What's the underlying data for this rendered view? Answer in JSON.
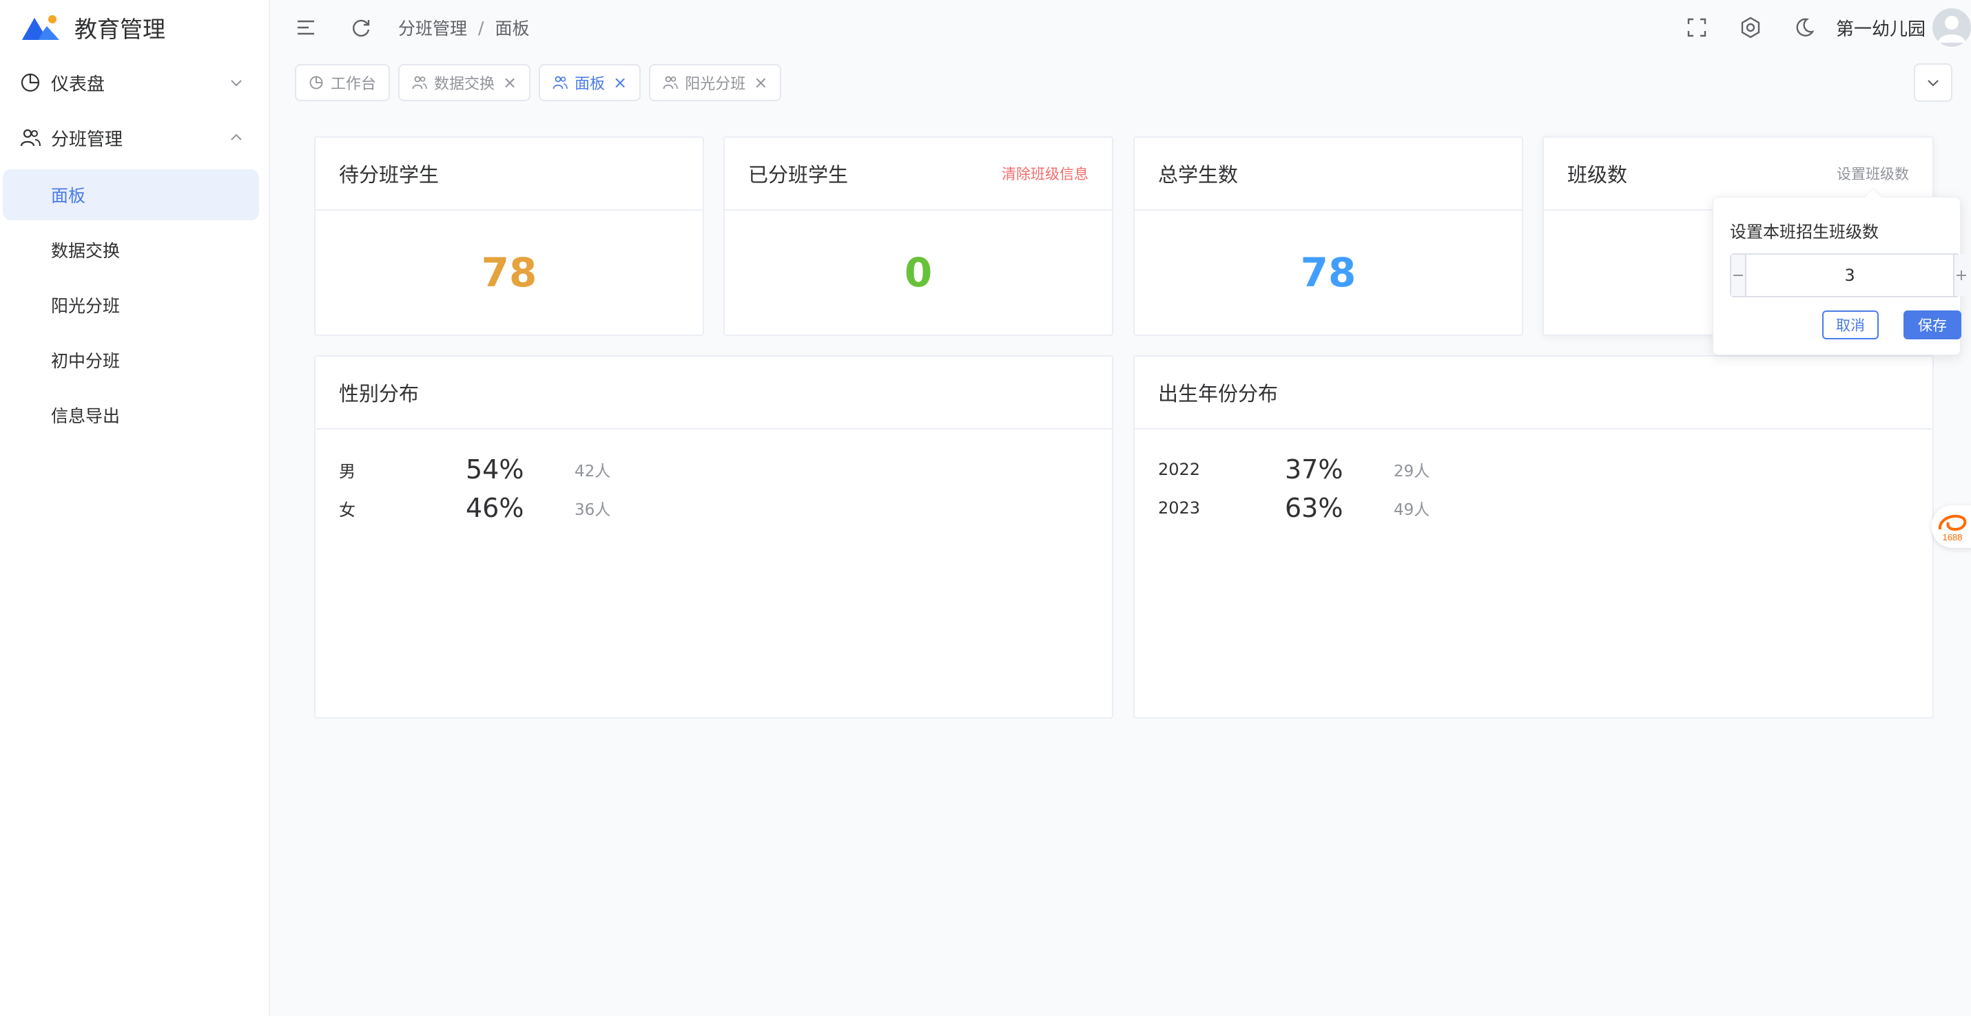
{
  "app": {
    "title": "教育管理"
  },
  "sidebar": {
    "items": [
      {
        "label": "仪表盘",
        "icon": "pie-chart-icon",
        "expanded": false
      },
      {
        "label": "分班管理",
        "icon": "users-icon",
        "expanded": true,
        "children": [
          {
            "label": "面板",
            "active": true
          },
          {
            "label": "数据交换",
            "active": false
          },
          {
            "label": "阳光分班",
            "active": false
          },
          {
            "label": "初中分班",
            "active": false
          },
          {
            "label": "信息导出",
            "active": false
          }
        ]
      }
    ]
  },
  "header": {
    "breadcrumb": [
      "分班管理",
      "面板"
    ],
    "breadcrumb_sep": "/",
    "username": "第一幼儿园"
  },
  "tabs": [
    {
      "label": "工作台",
      "icon": "pie-chart-icon",
      "closable": false,
      "active": false
    },
    {
      "label": "数据交换",
      "icon": "users-icon",
      "closable": true,
      "active": false
    },
    {
      "label": "面板",
      "icon": "users-icon",
      "closable": true,
      "active": true
    },
    {
      "label": "阳光分班",
      "icon": "users-icon",
      "closable": true,
      "active": false
    }
  ],
  "stats": [
    {
      "title": "待分班学生",
      "value": "78",
      "color": "#e6a23c",
      "link": ""
    },
    {
      "title": "已分班学生",
      "value": "0",
      "color": "#67c23a",
      "link": "清除班级信息",
      "link_color": "#f56c6c"
    },
    {
      "title": "总学生数",
      "value": "78",
      "color": "#409eff",
      "link": ""
    },
    {
      "title": "班级数",
      "value": "",
      "color": "#409eff",
      "link": "设置班级数",
      "link_color": "#909399"
    }
  ],
  "gender": {
    "title": "性别分布",
    "rows": [
      {
        "label": "男",
        "percent": "54%",
        "count": "42人"
      },
      {
        "label": "女",
        "percent": "46%",
        "count": "36人"
      }
    ]
  },
  "birth_year": {
    "title": "出生年份分布",
    "rows": [
      {
        "label": "2022",
        "percent": "37%",
        "count": "29人"
      },
      {
        "label": "2023",
        "percent": "63%",
        "count": "49人"
      }
    ]
  },
  "popover": {
    "title": "设置本班招生班级数",
    "value": "3",
    "cancel_label": "取消",
    "save_label": "保存"
  },
  "colors": {
    "primary": "#4a7be8",
    "danger": "#f56c6c",
    "badge": "#ff6a00"
  },
  "float_badge": {
    "text": "1688"
  }
}
